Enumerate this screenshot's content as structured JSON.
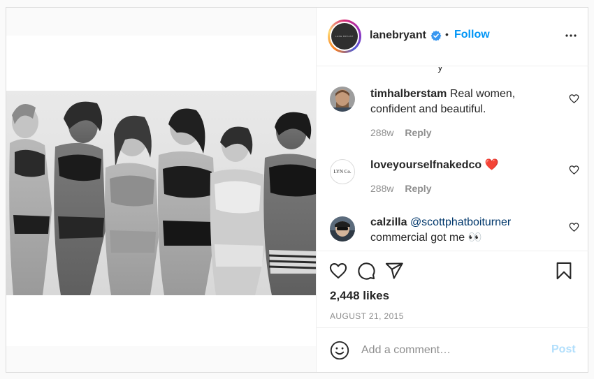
{
  "header": {
    "avatar_text": "LANE BRYANT",
    "username": "lanebryant",
    "separator": "•",
    "follow_label": "Follow",
    "icons": {
      "verified": "verified-badge-icon",
      "more": "more-options-icon"
    }
  },
  "comments": {
    "clipped_text": "      y",
    "items": [
      {
        "username": "timhalberstam",
        "text": "Real women, confident and beautiful.",
        "mention": "",
        "time": "288w",
        "reply_label": "Reply"
      },
      {
        "username": "loveyourselfnakedco",
        "avatar_text": "LYN Co.",
        "text": "❤️",
        "mention": "",
        "time": "288w",
        "reply_label": "Reply"
      },
      {
        "username": "calzilla",
        "mention": "@scottphatboiturner",
        "text": "commercial got me 👀"
      }
    ]
  },
  "actions": {
    "likes": "2,448 likes",
    "date": "AUGUST 21, 2015",
    "icons": [
      "heart-icon",
      "comment-icon",
      "share-icon",
      "bookmark-icon"
    ]
  },
  "add_comment": {
    "placeholder": "Add a comment…",
    "post_label": "Post"
  },
  "colors": {
    "accent": "#0095f6",
    "post_disabled": "#b2dffc",
    "muted": "#8e8e8e",
    "border": "#dbdbdb"
  }
}
